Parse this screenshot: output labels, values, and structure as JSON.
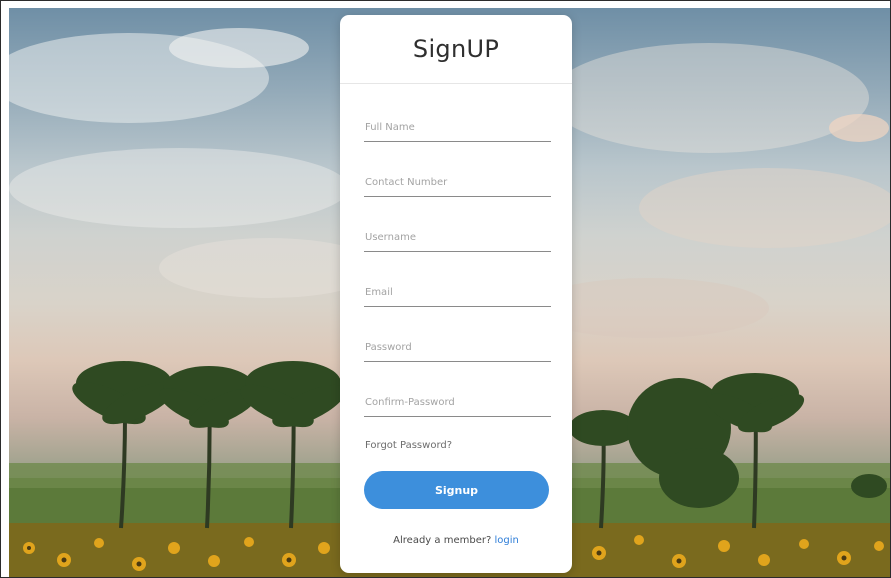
{
  "form": {
    "title": "SignUP",
    "fields": [
      {
        "placeholder": "Full Name",
        "value": ""
      },
      {
        "placeholder": "Contact Number",
        "value": ""
      },
      {
        "placeholder": "Username",
        "value": ""
      },
      {
        "placeholder": "Email",
        "value": ""
      },
      {
        "placeholder": "Password",
        "value": ""
      },
      {
        "placeholder": "Confirm-Password",
        "value": ""
      }
    ],
    "forgot_label": "Forgot Password?",
    "submit_label": "Signup",
    "member_text": "Already a member?",
    "login_label": "login"
  },
  "colors": {
    "accent": "#3d8fdc",
    "link": "#2f7ed8"
  },
  "background": {
    "icon": "sunflower-field-landscape"
  }
}
